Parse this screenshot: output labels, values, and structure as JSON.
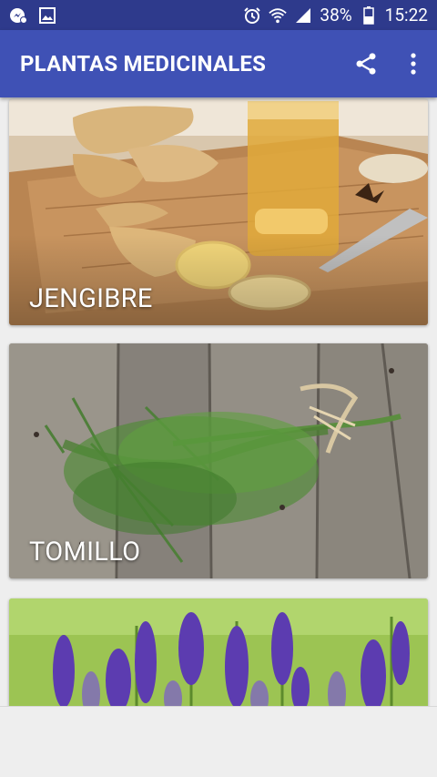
{
  "status_bar": {
    "battery_percent": "38%",
    "time": "15:22",
    "icons": [
      "messenger-icon",
      "image-icon",
      "alarm-icon",
      "wifi-icon",
      "signal-icon",
      "battery-icon"
    ]
  },
  "app_bar": {
    "title": "PLANTAS MEDICINALES",
    "actions": [
      "share-icon",
      "more-vert-icon"
    ]
  },
  "plants": [
    {
      "name": "JENGIBRE"
    },
    {
      "name": "TOMILLO"
    },
    {
      "name": ""
    }
  ],
  "colors": {
    "status_bar": "#2e3a8c",
    "app_bar": "#3f51b5",
    "background": "#eeeeee"
  }
}
